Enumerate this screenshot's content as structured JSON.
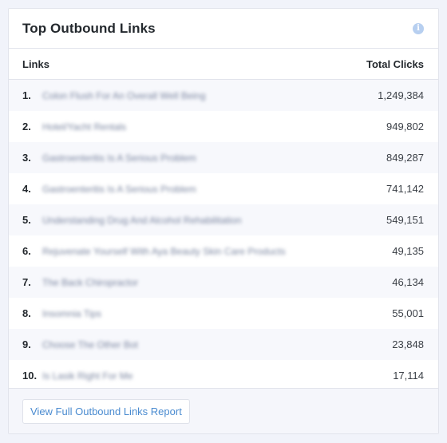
{
  "widget": {
    "title": "Top Outbound Links",
    "info_icon": "info-icon",
    "columns": {
      "links": "Links",
      "total_clicks": "Total Clicks"
    },
    "rows": [
      {
        "rank": "1.",
        "link": "Colon Flush For An Overall Well Being",
        "clicks": "1,249,384"
      },
      {
        "rank": "2.",
        "link": "Hotel/Yacht Rentals",
        "clicks": "949,802"
      },
      {
        "rank": "3.",
        "link": "Gastroenteritis Is A Serious Problem",
        "clicks": "849,287"
      },
      {
        "rank": "4.",
        "link": "Gastroenteritis Is A Serious Problem",
        "clicks": "741,142"
      },
      {
        "rank": "5.",
        "link": "Understanding Drug And Alcohol Rehabilitation",
        "clicks": "549,151"
      },
      {
        "rank": "6.",
        "link": "Rejuvenate Yourself With Aya Beauty Skin Care Products",
        "clicks": "49,135"
      },
      {
        "rank": "7.",
        "link": "The Back Chiropractor",
        "clicks": "46,134"
      },
      {
        "rank": "8.",
        "link": "Insomnia Tips",
        "clicks": "55,001"
      },
      {
        "rank": "9.",
        "link": "Choose The Other Bot",
        "clicks": "23,848"
      },
      {
        "rank": "10.",
        "link": "Is Lasik Right For Me",
        "clicks": "17,114"
      }
    ],
    "footer_button": "View Full Outbound Links Report"
  },
  "colors": {
    "page_background": "#f1f3fa",
    "accent_link": "#4a8bd0",
    "info_icon": "#b7cff0"
  }
}
